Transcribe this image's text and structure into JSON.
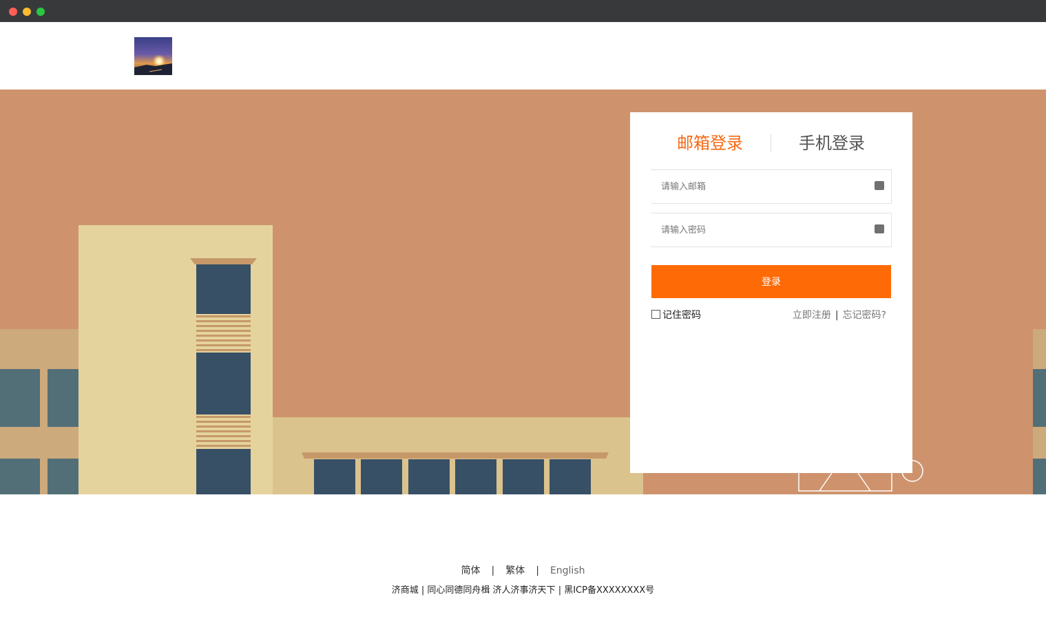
{
  "login": {
    "tab_email": "邮箱登录",
    "tab_phone": "手机登录",
    "email_placeholder": "请输入邮箱",
    "password_placeholder": "请输入密码",
    "submit_label": "登录",
    "remember_label": "记住密码",
    "register_link": "立即注册",
    "link_separator": "|",
    "forgot_link": "忘记密码?"
  },
  "footer": {
    "languages": [
      "简体",
      "繁体",
      "English"
    ],
    "separator": "|",
    "copyright": "济商城 | 同心同德同舟楫 济人济事济天下 | 黑ICP备XXXXXXXX号"
  },
  "colors": {
    "accent": "#f56a16",
    "button": "#fe6a05",
    "banner_bg": "#ce936d"
  },
  "icons": {
    "field_icon": "keyboard-icon",
    "logo": "sunset-logo"
  }
}
